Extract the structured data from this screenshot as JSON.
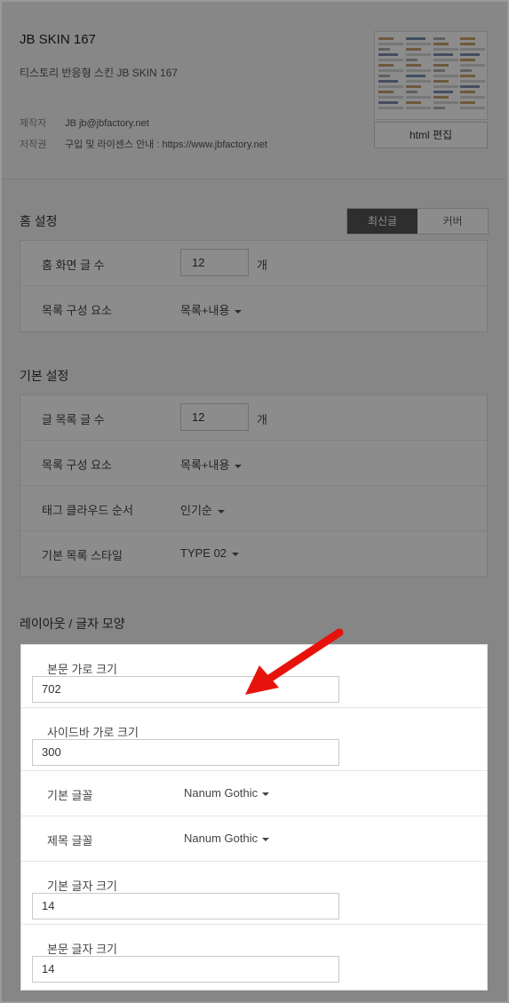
{
  "skin": {
    "title": "JB SKIN 167",
    "description": "티스토리 반응형 스킨 JB SKIN 167",
    "maker_label": "제작자",
    "maker_value": "JB jb@jbfactory.net",
    "copyright_label": "저작권",
    "copyright_value": "구입 및 라이센스 안내 : https://www.jbfactory.net",
    "html_edit_label": "html 편집"
  },
  "home_settings": {
    "title": "홈 설정",
    "tabs": [
      {
        "label": "최신글",
        "active": true
      },
      {
        "label": "커버",
        "active": false
      }
    ],
    "rows": [
      {
        "label": "홈 화면 글 수",
        "value": "12",
        "unit": "개"
      },
      {
        "label": "목록 구성 요소",
        "value": "목록+내용"
      }
    ]
  },
  "basic_settings": {
    "title": "기본 설정",
    "rows": [
      {
        "label": "글 목록 글 수",
        "value": "12",
        "unit": "개"
      },
      {
        "label": "목록 구성 요소",
        "value": "목록+내용"
      },
      {
        "label": "태그 클라우드 순서",
        "value": "인기순"
      },
      {
        "label": "기본 목록 스타일",
        "value": "TYPE 02"
      }
    ]
  },
  "layout_settings": {
    "title": "레이아웃 / 글자 모양",
    "rows": [
      {
        "label": "본문 가로 크기",
        "value": "702"
      },
      {
        "label": "사이드바 가로 크기",
        "value": "300"
      },
      {
        "label": "기본 글꼴",
        "value": "Nanum Gothic"
      },
      {
        "label": "제목 글꼴",
        "value": "Nanum Gothic"
      },
      {
        "label": "기본 글자 크기",
        "value": "14"
      },
      {
        "label": "본문 글자 크기",
        "value": "14"
      }
    ]
  },
  "annotation": {
    "arrow_color": "#e8120c"
  }
}
